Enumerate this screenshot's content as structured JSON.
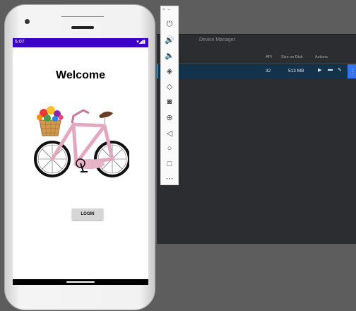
{
  "device_manager": {
    "title": "Device Manager",
    "columns": {
      "api": "API",
      "size": "Size on Disk",
      "actions": "Actions"
    },
    "device_row": {
      "api": "32",
      "size": "513 MB"
    }
  },
  "toolbar": {
    "close": "×",
    "minimize": "–",
    "icons": [
      "power-icon",
      "volume-up-icon",
      "volume-down-icon",
      "rotate-left-icon",
      "rotate-right-icon",
      "camera-icon",
      "zoom-icon",
      "back-icon",
      "home-icon",
      "overview-icon",
      "more-icon"
    ]
  },
  "phone": {
    "status": {
      "time": "5:07",
      "signal_icons": "▾◢▮"
    },
    "app": {
      "welcome_text": "Welcome",
      "login_label": "LOGIN"
    }
  }
}
